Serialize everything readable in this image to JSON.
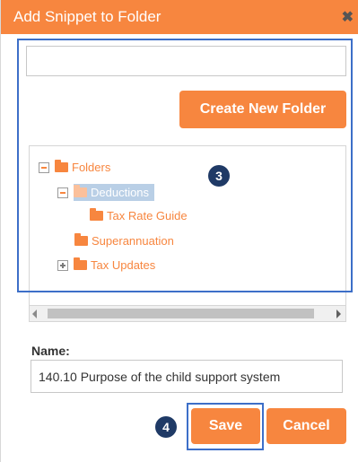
{
  "dialog": {
    "title": "Add Snippet to Folder",
    "close_glyph": "✖",
    "close_icon": "close-icon"
  },
  "search": {
    "value": "",
    "placeholder": ""
  },
  "create_folder": {
    "label": "Create New Folder"
  },
  "tree": {
    "nodes": [
      {
        "label": "Folders",
        "toggle": "minus",
        "icon": "folder-icon"
      },
      {
        "label": "Deductions",
        "toggle": "minus",
        "icon": "folder-icon",
        "selected": true
      },
      {
        "label": "Tax Rate Guide",
        "icon": "folder-icon"
      },
      {
        "label": "Superannuation",
        "icon": "folder-icon"
      },
      {
        "label": "Tax Updates",
        "toggle": "plus",
        "icon": "folder-icon"
      }
    ]
  },
  "badges": {
    "step3": "3",
    "step4": "4"
  },
  "name_field": {
    "label": "Name:",
    "value": "140.10 Purpose of the child support system"
  },
  "actions": {
    "save_label": "Save",
    "cancel_label": "Cancel"
  },
  "colors": {
    "accent": "#f7863f",
    "highlight_border": "#3d6fc8",
    "badge": "#1f3a66",
    "selection": "#b9cfe6"
  }
}
